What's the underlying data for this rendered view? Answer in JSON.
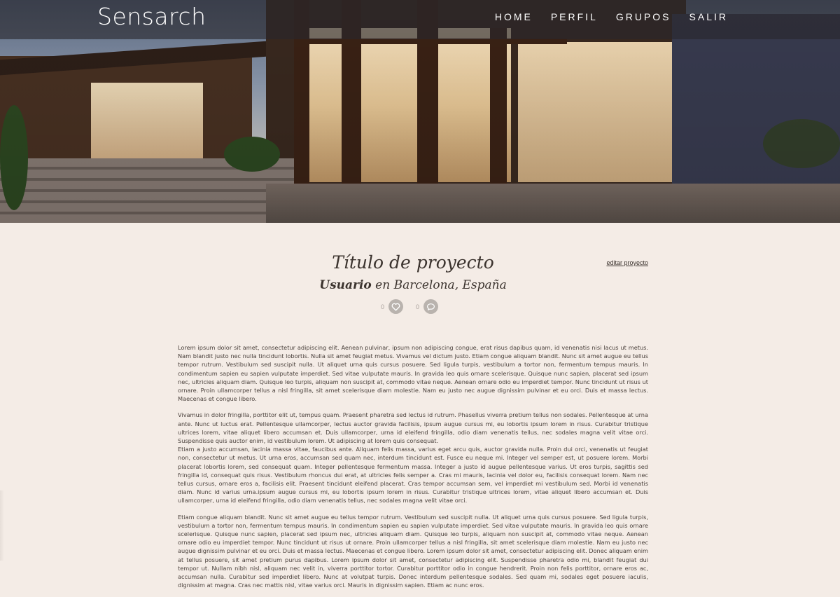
{
  "header": {
    "logo": "Sensarch",
    "nav": [
      "HOME",
      "PERFIL",
      "GRUPOS",
      "SALIR"
    ]
  },
  "project": {
    "title": "Título de proyecto",
    "user": "Usuario",
    "location": " en Barcelona, España",
    "edit_label": "editar proyecto",
    "likes": "0",
    "comments": "0"
  },
  "body": {
    "paragraphs": [
      "Lorem ipsum dolor sit amet, consectetur adipiscing elit. Aenean pulvinar, ipsum non adipiscing congue, erat risus dapibus quam, id venenatis nisi lacus ut metus. Nam blandit justo nec nulla tincidunt lobortis. Nulla sit amet feugiat metus. Vivamus vel dictum justo. Etiam congue aliquam blandit. Nunc sit amet augue eu tellus tempor rutrum. Vestibulum sed suscipit nulla. Ut aliquet urna quis cursus posuere. Sed ligula turpis, vestibulum a tortor non, fermentum tempus mauris. In condimentum sapien eu sapien vulputate imperdiet. Sed vitae vulputate mauris. In gravida leo quis ornare scelerisque. Quisque nunc sapien, placerat sed ipsum nec, ultricies aliquam diam. Quisque leo turpis, aliquam non suscipit at, commodo vitae neque. Aenean ornare odio eu imperdiet tempor. Nunc tincidunt ut risus ut ornare. Proin ullamcorper tellus a nisl fringilla, sit amet scelerisque diam molestie. Nam eu justo nec augue dignissim pulvinar et eu orci. Duis et massa lectus. Maecenas et congue libero.",
      "Vivamus in dolor fringilla, porttitor elit ut, tempus quam. Praesent pharetra sed lectus id rutrum. Phasellus viverra pretium tellus non sodales. Pellentesque at urna ante. Nunc ut luctus erat. Pellentesque ullamcorper, lectus auctor gravida facilisis, ipsum augue cursus mi, eu lobortis ipsum lorem in risus. Curabitur tristique ultrices lorem, vitae aliquet libero accumsan et. Duis ullamcorper, urna id eleifend fringilla, odio diam venenatis tellus, nec sodales magna velit vitae orci. Suspendisse quis auctor enim, id vestibulum lorem. Ut adipiscing at lorem quis consequat.",
      "Etiam a justo accumsan, lacinia massa vitae, faucibus ante. Aliquam felis massa, varius eget arcu quis, auctor gravida nulla. Proin dui orci, venenatis ut feugiat non, consectetur ut metus. Ut urna eros, accumsan sed quam nec, interdum tincidunt est. Fusce eu neque mi. Integer vel semper est, ut posuere lorem. Morbi placerat lobortis lorem, sed consequat quam. Integer pellentesque fermentum massa. Integer a justo id augue pellentesque varius. Ut eros turpis, sagittis sed fringilla id, consequat quis risus. Vestibulum rhoncus dui erat, at ultricies felis semper a. Cras mi mauris, lacinia vel dolor eu, facilisis consequat lorem. Nam nec tellus cursus, ornare eros a, facilisis elit. Praesent tincidunt eleifend placerat. Cras tempor accumsan sem, vel imperdiet mi vestibulum sed. Morbi id venenatis diam. Nunc id varius urna.ipsum augue cursus mi, eu lobortis ipsum lorem in risus. Curabitur tristique ultrices lorem, vitae aliquet libero accumsan et. Duis ullamcorper, urna id eleifend fringilla, odio diam venenatis tellus, nec sodales magna velit vitae orci.",
      "Etiam congue aliquam blandit. Nunc sit amet augue eu tellus tempor rutrum. Vestibulum sed suscipit nulla. Ut aliquet urna quis cursus posuere. Sed ligula turpis, vestibulum a tortor non, fermentum tempus mauris. In condimentum sapien eu sapien vulputate imperdiet. Sed vitae vulputate mauris. In gravida leo quis ornare scelerisque. Quisque nunc sapien, placerat sed ipsum nec, ultricies aliquam diam. Quisque leo turpis, aliquam non suscipit at, commodo vitae neque. Aenean ornare odio eu imperdiet tempor. Nunc tincidunt ut risus ut ornare. Proin ullamcorper tellus a nisl fringilla, sit amet scelerisque diam molestie. Nam eu justo nec augue dignissim pulvinar et eu orci. Duis et massa lectus. Maecenas et congue libero. Lorem ipsum dolor sit amet, consectetur adipiscing elit. Donec aliquam enim at tellus posuere, sit amet pretium purus dapibus. Lorem ipsum dolor sit amet, consectetur adipiscing elit. Suspendisse pharetra odio mi, blandit feugiat dui tempor ut. Nullam nibh nisl, aliquam nec velit in, viverra porttitor tortor. Curabitur porttitor odio in congue hendrerit. Proin non felis porttitor, ornare eros ac, accumsan nulla. Curabitur sed imperdiet libero. Nunc at volutpat turpis. Donec interdum pellentesque sodales. Sed quam mi, sodales eget posuere iaculis, dignissim at magna. Cras nec mattis nisl, vitae varius orci. Mauris in dignissim sapien. Etiam ac nunc eros."
    ]
  },
  "colors": {
    "page_bg": "#f4ece6",
    "nav_bg": "rgba(40,38,44,0.62)",
    "text": "#3b332e",
    "icon_bg": "#b9b3ae"
  },
  "icons": [
    "heart-icon",
    "comment-icon"
  ]
}
